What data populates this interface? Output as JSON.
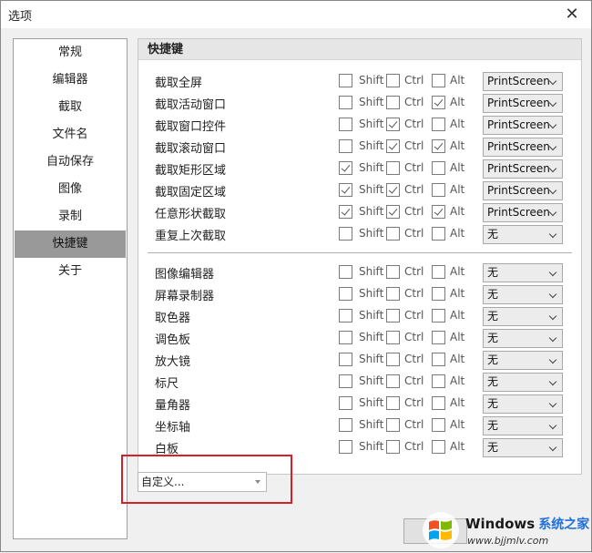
{
  "window": {
    "title": "选项",
    "close_glyph": "✕"
  },
  "sidebar": {
    "items": [
      {
        "label": "常规",
        "active": false
      },
      {
        "label": "编辑器",
        "active": false
      },
      {
        "label": "截取",
        "active": false
      },
      {
        "label": "文件名",
        "active": false
      },
      {
        "label": "自动保存",
        "active": false
      },
      {
        "label": "图像",
        "active": false
      },
      {
        "label": "录制",
        "active": false
      },
      {
        "label": "快捷键",
        "active": true
      },
      {
        "label": "关于",
        "active": false
      }
    ]
  },
  "hotkeys": {
    "section_title": "快捷键",
    "modifier_labels": {
      "shift": "Shift",
      "ctrl": "Ctrl",
      "alt": "Alt"
    },
    "capture_rows": [
      {
        "label": "截取全屏",
        "shift": false,
        "ctrl": false,
        "alt": false,
        "key": "PrintScreen"
      },
      {
        "label": "截取活动窗口",
        "shift": false,
        "ctrl": false,
        "alt": true,
        "key": "PrintScreen"
      },
      {
        "label": "截取窗口控件",
        "shift": false,
        "ctrl": true,
        "alt": false,
        "key": "PrintScreen"
      },
      {
        "label": "截取滚动窗口",
        "shift": false,
        "ctrl": true,
        "alt": true,
        "key": "PrintScreen"
      },
      {
        "label": "截取矩形区域",
        "shift": true,
        "ctrl": false,
        "alt": false,
        "key": "PrintScreen"
      },
      {
        "label": "截取固定区域",
        "shift": true,
        "ctrl": true,
        "alt": false,
        "key": "PrintScreen"
      },
      {
        "label": "任意形状截取",
        "shift": true,
        "ctrl": true,
        "alt": true,
        "key": "PrintScreen"
      },
      {
        "label": "重复上次截取",
        "shift": false,
        "ctrl": false,
        "alt": false,
        "key": "无"
      }
    ],
    "tool_rows": [
      {
        "label": "图像编辑器",
        "shift": false,
        "ctrl": false,
        "alt": false,
        "key": "无"
      },
      {
        "label": "屏幕录制器",
        "shift": false,
        "ctrl": false,
        "alt": false,
        "key": "无"
      },
      {
        "label": "取色器",
        "shift": false,
        "ctrl": false,
        "alt": false,
        "key": "无"
      },
      {
        "label": "调色板",
        "shift": false,
        "ctrl": false,
        "alt": false,
        "key": "无"
      },
      {
        "label": "放大镜",
        "shift": false,
        "ctrl": false,
        "alt": false,
        "key": "无"
      },
      {
        "label": "标尺",
        "shift": false,
        "ctrl": false,
        "alt": false,
        "key": "无"
      },
      {
        "label": "量角器",
        "shift": false,
        "ctrl": false,
        "alt": false,
        "key": "无"
      },
      {
        "label": "坐标轴",
        "shift": false,
        "ctrl": false,
        "alt": false,
        "key": "无"
      },
      {
        "label": "白板",
        "shift": false,
        "ctrl": false,
        "alt": false,
        "key": "无"
      }
    ]
  },
  "preset": {
    "value": "自定义..."
  },
  "watermark": {
    "brand": "Windows",
    "site_name": "系统之家",
    "url": "www.bjjmlv.com",
    "colors": {
      "red": "#f25022",
      "green": "#7fba00",
      "blue": "#00a4ef",
      "yellow": "#ffb900"
    }
  },
  "colors": {
    "highlight_box": "#d61f26",
    "active_nav": "#999999"
  }
}
